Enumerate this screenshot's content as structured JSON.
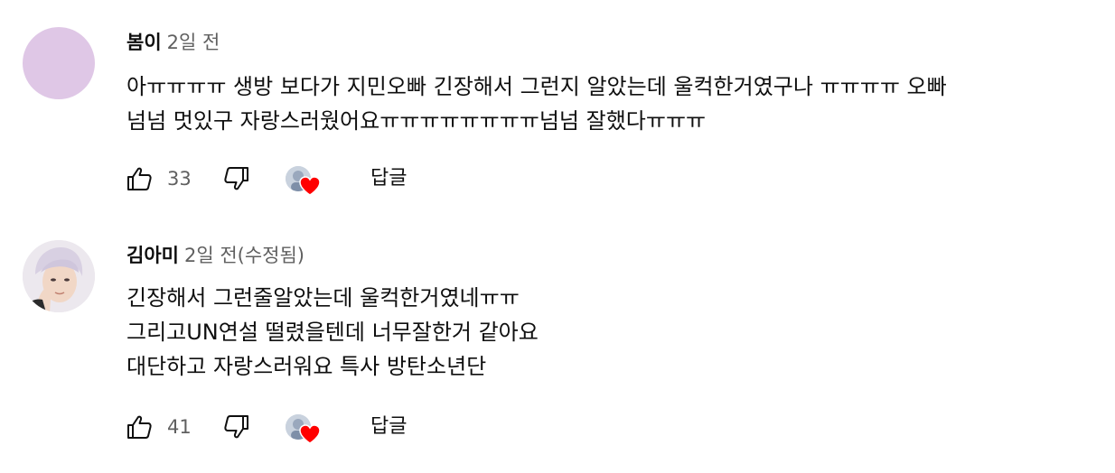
{
  "comments": [
    {
      "author": "봄이",
      "time": "2일 전",
      "edited": "",
      "lines": [
        "아ㅠㅠㅠㅠ 생방 보다가 지민오빠 긴장해서 그런지 알았는데 울컥한거였구나 ㅠㅠㅠㅠ 오빠",
        "넘넘 멋있구 자랑스러웠어요ㅠㅠㅠㅠㅠㅠㅠㅠ넘넘 잘했다ㅠㅠㅠ"
      ],
      "likes": "33",
      "reply_label": "답글",
      "avatar_color": "#dfc7e6"
    },
    {
      "author": "김아미",
      "time": "2일 전",
      "edited": "(수정됨)",
      "lines": [
        "긴장해서 그런줄알았는데 울컥한거였네ㅠㅠ",
        "그리고UN연설 떨렸을텐데 너무잘한거 같아요",
        "대단하고 자랑스러워요 특사 방탄소년단"
      ],
      "likes": "41",
      "reply_label": "답글",
      "avatar_color": "#e9e6ea"
    }
  ],
  "icons": {
    "like": "thumbs-up-icon",
    "dislike": "thumbs-down-icon",
    "creator_heart": "heart-icon"
  },
  "colors": {
    "heart": "#ff0000",
    "secondary_text": "#606060",
    "primary_text": "#0f0f0f"
  }
}
